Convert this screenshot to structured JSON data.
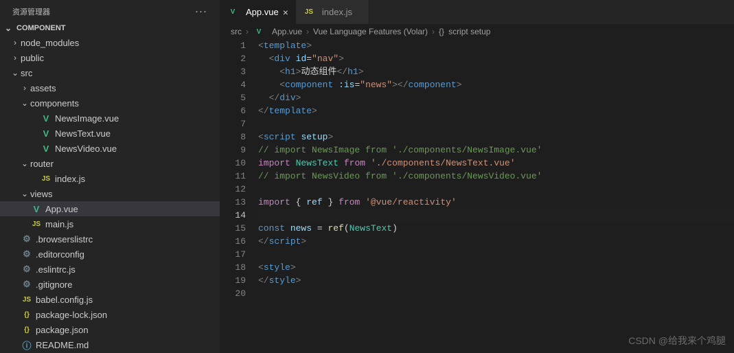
{
  "sidebar": {
    "title": "资源管理器",
    "section": "COMPONENT",
    "tree": [
      {
        "label": "node_modules",
        "type": "folder",
        "depth": 0,
        "expanded": false
      },
      {
        "label": "public",
        "type": "folder",
        "depth": 0,
        "expanded": false
      },
      {
        "label": "src",
        "type": "folder",
        "depth": 0,
        "expanded": true
      },
      {
        "label": "assets",
        "type": "folder",
        "depth": 1,
        "expanded": false
      },
      {
        "label": "components",
        "type": "folder",
        "depth": 1,
        "expanded": true
      },
      {
        "label": "NewsImage.vue",
        "type": "vue",
        "depth": 2
      },
      {
        "label": "NewsText.vue",
        "type": "vue",
        "depth": 2
      },
      {
        "label": "NewsVideo.vue",
        "type": "vue",
        "depth": 2
      },
      {
        "label": "router",
        "type": "folder",
        "depth": 1,
        "expanded": true
      },
      {
        "label": "index.js",
        "type": "js",
        "depth": 2
      },
      {
        "label": "views",
        "type": "folder",
        "depth": 1,
        "expanded": true
      },
      {
        "label": "App.vue",
        "type": "vue",
        "depth": 1,
        "active": true
      },
      {
        "label": "main.js",
        "type": "js",
        "depth": 1
      },
      {
        "label": ".browserslistrc",
        "type": "gear",
        "depth": 0
      },
      {
        "label": ".editorconfig",
        "type": "gear",
        "depth": 0
      },
      {
        "label": ".eslintrc.js",
        "type": "gear",
        "depth": 0
      },
      {
        "label": ".gitignore",
        "type": "gear",
        "depth": 0
      },
      {
        "label": "babel.config.js",
        "type": "js",
        "depth": 0
      },
      {
        "label": "package-lock.json",
        "type": "json",
        "depth": 0
      },
      {
        "label": "package.json",
        "type": "json",
        "depth": 0
      },
      {
        "label": "README.md",
        "type": "readme",
        "depth": 0
      }
    ]
  },
  "tabs": [
    {
      "label": "App.vue",
      "type": "vue",
      "active": true
    },
    {
      "label": "index.js",
      "type": "js",
      "active": false
    }
  ],
  "breadcrumb": {
    "parts": [
      "src",
      "App.vue",
      "Vue Language Features (Volar)",
      "script setup"
    ],
    "icons": [
      "",
      "vue",
      "",
      "braces"
    ]
  },
  "editor": {
    "current_line": 14,
    "lines": [
      {
        "n": 1,
        "html": "<span class='tag'>&lt;</span><span class='tagname'>template</span><span class='tag'>&gt;</span>"
      },
      {
        "n": 2,
        "html": "  <span class='tag'>&lt;</span><span class='tagname'>div</span> <span class='attr'>id</span><span class='pun'>=</span><span class='str'>\"nav\"</span><span class='tag'>&gt;</span>"
      },
      {
        "n": 3,
        "html": "    <span class='tag'>&lt;</span><span class='tagname'>h1</span><span class='tag'>&gt;</span><span class='txt'>动态组件</span><span class='tag'>&lt;/</span><span class='tagname'>h1</span><span class='tag'>&gt;</span>"
      },
      {
        "n": 4,
        "html": "    <span class='tag'>&lt;</span><span class='tagname'>component</span> <span class='attr'>:is</span><span class='pun'>=</span><span class='str'>\"news\"</span><span class='tag'>&gt;&lt;/</span><span class='tagname'>component</span><span class='tag'>&gt;</span>"
      },
      {
        "n": 5,
        "html": "  <span class='tag'>&lt;/</span><span class='tagname'>div</span><span class='tag'>&gt;</span>"
      },
      {
        "n": 6,
        "html": "<span class='tag'>&lt;/</span><span class='tagname'>template</span><span class='tag'>&gt;</span>"
      },
      {
        "n": 7,
        "html": ""
      },
      {
        "n": 8,
        "html": "<span class='tag'>&lt;</span><span class='tagname'>script</span> <span class='attr'>setup</span><span class='tag'>&gt;</span>"
      },
      {
        "n": 9,
        "html": "<span class='cmt'>// import NewsImage from './components/NewsImage.vue'</span>"
      },
      {
        "n": 10,
        "html": "<span class='kw'>import</span> <span class='cls'>NewsText</span> <span class='kw'>from</span> <span class='str'>'./components/NewsText.vue'</span>"
      },
      {
        "n": 11,
        "html": "<span class='cmt'>// import NewsVideo from './components/NewsVideo.vue'</span>"
      },
      {
        "n": 12,
        "html": ""
      },
      {
        "n": 13,
        "html": "<span class='kw'>import</span> <span class='pun'>{</span> <span class='var'>ref</span> <span class='pun'>}</span> <span class='kw'>from</span> <span class='str'>'@vue/reactivity'</span>"
      },
      {
        "n": 14,
        "html": ""
      },
      {
        "n": 15,
        "html": "<span class='op'>const</span> <span class='var'>news</span> <span class='pun'>=</span> <span class='fn'>ref</span><span class='pun'>(</span><span class='cls'>NewsText</span><span class='pun'>)</span>"
      },
      {
        "n": 16,
        "html": "<span class='tag'>&lt;/</span><span class='tagname'>script</span><span class='tag'>&gt;</span>"
      },
      {
        "n": 17,
        "html": ""
      },
      {
        "n": 18,
        "html": "<span class='tag'>&lt;</span><span class='tagname'>style</span><span class='tag'>&gt;</span>"
      },
      {
        "n": 19,
        "html": "<span class='tag'>&lt;/</span><span class='tagname'>style</span><span class='tag'>&gt;</span>"
      },
      {
        "n": 20,
        "html": ""
      }
    ]
  },
  "watermark": "CSDN @给我来个鸡腿"
}
